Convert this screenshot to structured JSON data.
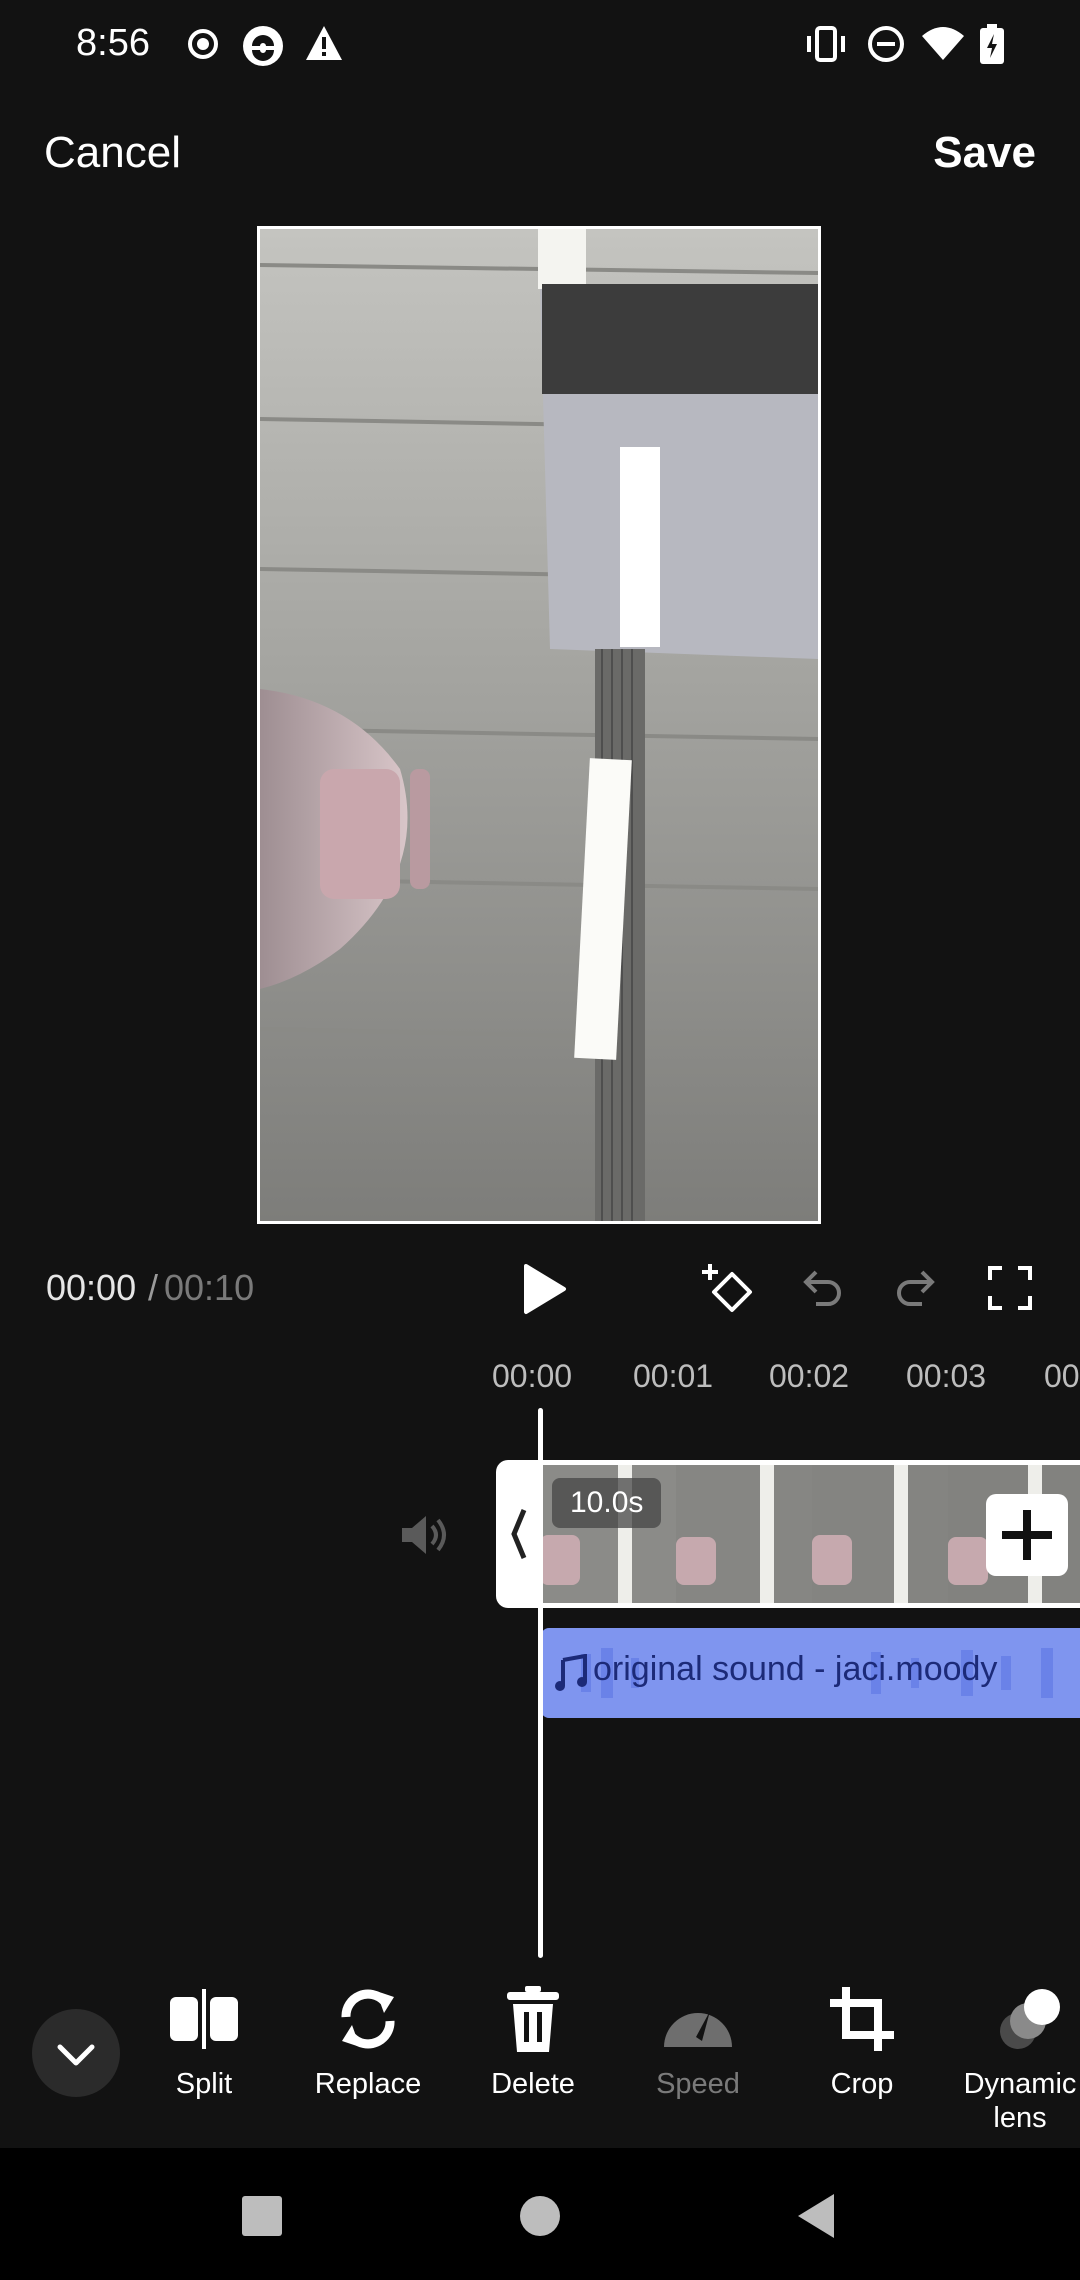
{
  "status_bar": {
    "time": "8:56"
  },
  "header": {
    "cancel_label": "Cancel",
    "save_label": "Save"
  },
  "playback": {
    "current_time": "00:00",
    "separator": "/",
    "total_time": "00:10"
  },
  "ruler": {
    "ticks": [
      "00:00",
      "00:01",
      "00:02",
      "00:03",
      "00"
    ]
  },
  "timeline": {
    "clip_duration": "10.0s",
    "audio_label": "original sound - jaci.moody"
  },
  "toolbar": {
    "tools": [
      {
        "label": "Split",
        "icon": "split-icon",
        "enabled": true
      },
      {
        "label": "Replace",
        "icon": "replace-icon",
        "enabled": true
      },
      {
        "label": "Delete",
        "icon": "trash-icon",
        "enabled": true
      },
      {
        "label": "Speed",
        "icon": "speedometer-icon",
        "enabled": false
      },
      {
        "label": "Crop",
        "icon": "crop-icon",
        "enabled": true
      },
      {
        "label": "Dynamic\nlens",
        "icon": "dynamic-lens-icon",
        "enabled": true
      }
    ]
  },
  "colors": {
    "background": "#121212",
    "audio_track": "#7f95ef",
    "audio_text": "#1c2a78"
  }
}
